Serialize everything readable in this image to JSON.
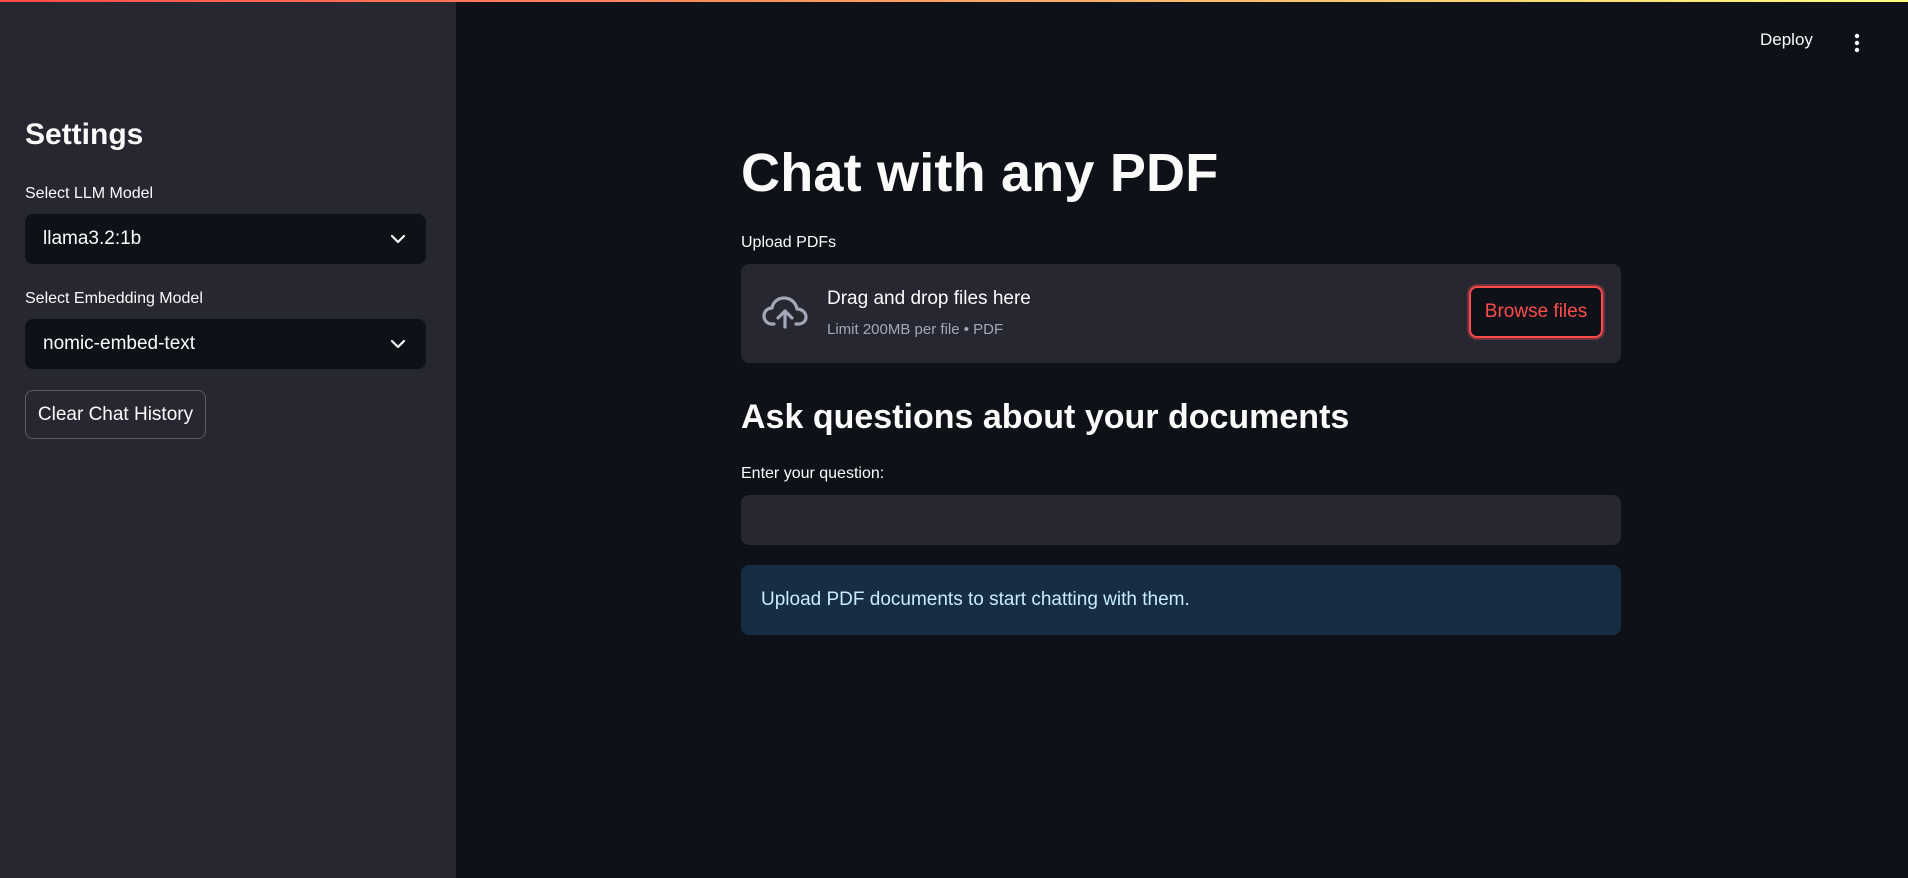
{
  "header": {
    "deploy_label": "Deploy",
    "menu_icon": "vertical-dots-icon"
  },
  "sidebar": {
    "title": "Settings",
    "llm_select": {
      "label": "Select LLM Model",
      "value": "llama3.2:1b"
    },
    "embedding_select": {
      "label": "Select Embedding Model",
      "value": "nomic-embed-text"
    },
    "clear_button_label": "Clear Chat History"
  },
  "main": {
    "title": "Chat with any PDF",
    "uploader": {
      "label": "Upload PDFs",
      "drop_text": "Drag and drop files here",
      "limit_text": "Limit 200MB per file • PDF",
      "browse_label": "Browse files",
      "icon": "cloud-upload-icon"
    },
    "section_title": "Ask questions about your documents",
    "question": {
      "label": "Enter your question:",
      "value": "",
      "placeholder": ""
    },
    "info_message": "Upload PDF documents to start chatting with them."
  },
  "colors": {
    "background": "#0e1117",
    "sidebar": "#262730",
    "accent": "#ff4b4b",
    "info_background": "#172d43",
    "info_text": "#c7ebff"
  }
}
